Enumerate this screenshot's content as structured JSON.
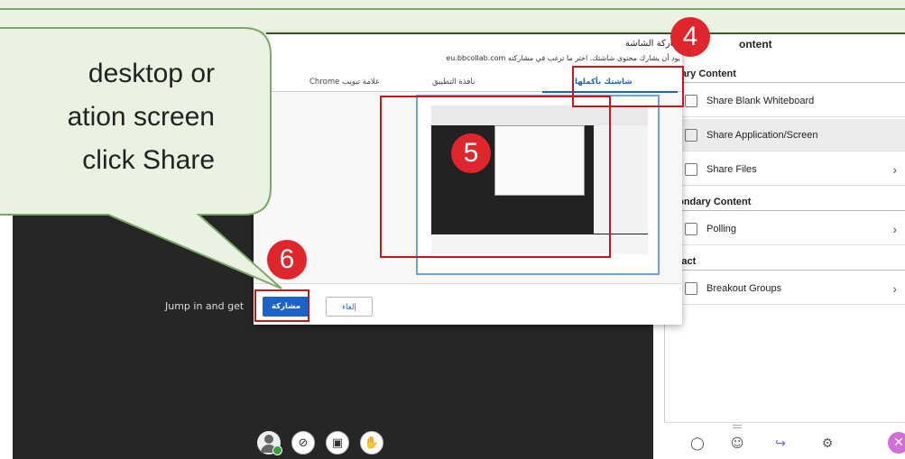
{
  "stage": {
    "text": "Jump in and get"
  },
  "panel": {
    "title": "ontent",
    "sections": [
      {
        "heading": "mary Content",
        "items": [
          {
            "label": "Share Blank Whiteboard",
            "icon": "whiteboard-icon",
            "chevron": false,
            "active": false
          },
          {
            "label": "Share Application/Screen",
            "icon": "screen-share-icon",
            "chevron": false,
            "active": true
          },
          {
            "label": "Share Files",
            "icon": "file-icon",
            "chevron": true,
            "active": false
          }
        ]
      },
      {
        "heading": "condary Content",
        "items": [
          {
            "label": "Polling",
            "icon": "poll-icon",
            "chevron": true,
            "active": false
          }
        ]
      },
      {
        "heading": "eract",
        "items": [
          {
            "label": "Breakout Groups",
            "icon": "groups-icon",
            "chevron": true,
            "active": false
          }
        ]
      }
    ]
  },
  "modal": {
    "title": "شاركة الشاشة",
    "subtitle": "يود أن يشارك محتوى شاشتك. اختر ما ترغب في مشاركته eu.bbcollab.com",
    "tabs": [
      "شاشتك بأكملها",
      "نافذة التطبيق",
      "علامة تبويب Chrome"
    ],
    "share_label": "مشاركة",
    "cancel_label": "إلغاء"
  },
  "callout": {
    "lines": [
      "desktop or",
      "ation screen",
      "click Share"
    ]
  },
  "markers": [
    "4",
    "5",
    "6"
  ],
  "colors": {
    "marker": "#e0262d",
    "callout_fill": "#eaf3e1",
    "callout_border": "#7fa66a",
    "accent": "#1c63c8"
  }
}
